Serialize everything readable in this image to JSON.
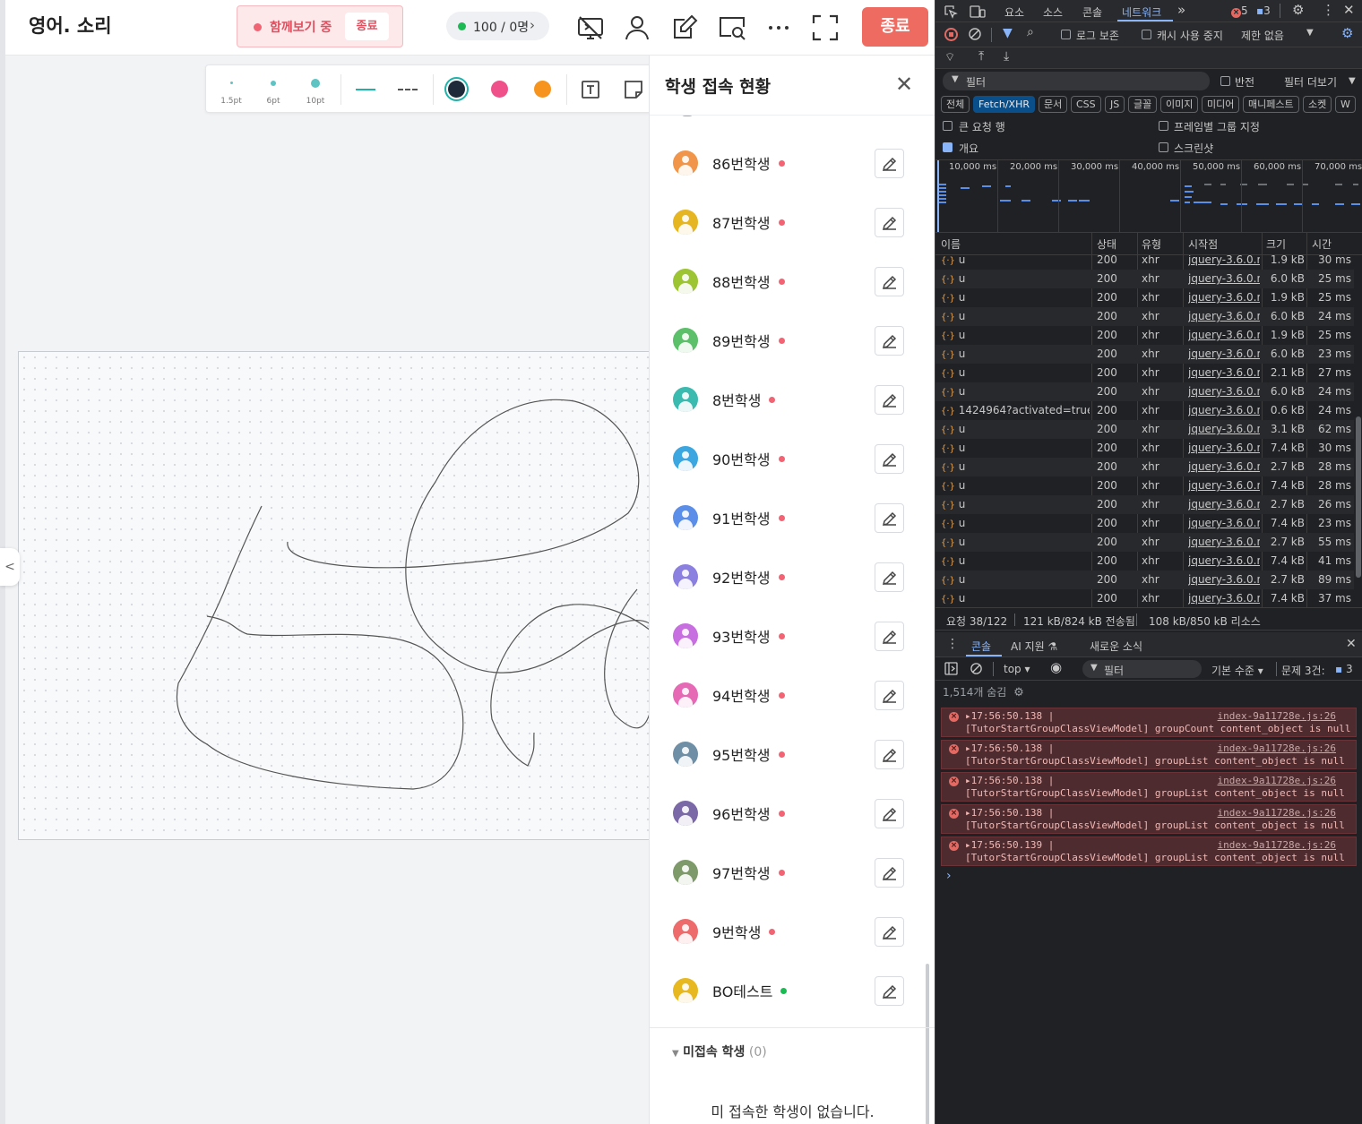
{
  "app": {
    "title": "영어. 소리",
    "together": {
      "label": "함께보기 중",
      "end": "종료"
    },
    "counter": {
      "text": "100 / 0명",
      "chevron": "›"
    },
    "end_button": "종료",
    "toolbar": {
      "pens": [
        "1.5pt",
        "6pt",
        "10pt"
      ],
      "lines": [
        "solid-line",
        "dashed-line"
      ],
      "colors": [
        "#1e2a3a",
        "#f0508a",
        "#f7941d"
      ]
    },
    "left_tab": "<",
    "panel": {
      "title": "학생 접속 현황",
      "close": "✕",
      "students": [
        {
          "name": "86번학생",
          "avatar": "#f0954a",
          "status": "#f06474"
        },
        {
          "name": "87번학생",
          "avatar": "#e6b522",
          "status": "#f06474"
        },
        {
          "name": "88번학생",
          "avatar": "#9cc433",
          "status": "#f06474"
        },
        {
          "name": "89번학생",
          "avatar": "#5cc06a",
          "status": "#f06474"
        },
        {
          "name": "8번학생",
          "avatar": "#3bbab0",
          "status": "#f06474"
        },
        {
          "name": "90번학생",
          "avatar": "#3ba6e0",
          "status": "#f06474"
        },
        {
          "name": "91번학생",
          "avatar": "#5b8ee8",
          "status": "#f06474"
        },
        {
          "name": "92번학생",
          "avatar": "#8b7fe0",
          "status": "#f06474"
        },
        {
          "name": "93번학생",
          "avatar": "#c76ee0",
          "status": "#f06474"
        },
        {
          "name": "94번학생",
          "avatar": "#e669b5",
          "status": "#f06474"
        },
        {
          "name": "95번학생",
          "avatar": "#6f8fa6",
          "status": "#f06474"
        },
        {
          "name": "96번학생",
          "avatar": "#7b68a6",
          "status": "#f06474"
        },
        {
          "name": "97번학생",
          "avatar": "#7f9a6a",
          "status": "#f06474"
        },
        {
          "name": "9번학생",
          "avatar": "#ee6b6b",
          "status": "#f06474"
        },
        {
          "name": "BO테스트",
          "avatar": "#e8b820",
          "status": "#1db954"
        }
      ],
      "offline_label": "미접속 학생",
      "offline_count": "(0)",
      "offline_empty": "미 접속한 학생이 없습니다."
    }
  },
  "devtools": {
    "tabs": [
      "요소",
      "소스",
      "콘솔",
      "네트워크"
    ],
    "more": "»",
    "error_count": "5",
    "message_count": "3",
    "toolbar": {
      "preserve_log": "로그 보존",
      "disable_cache": "캐시 사용 중지",
      "throttle": "제한 없음"
    },
    "filter": {
      "placeholder": "필터",
      "invert": "반전",
      "more_filters": "필터 더보기"
    },
    "types": [
      "전체",
      "Fetch/XHR",
      "문서",
      "CSS",
      "JS",
      "글꼴",
      "이미지",
      "미디어",
      "매니페스트",
      "소켓",
      "W"
    ],
    "options": {
      "big_rows": "큰 요청 행",
      "group_by_frame": "프레임별 그룹 지정",
      "overview": "개요",
      "screenshots": "스크린샷"
    },
    "timeline_ticks": [
      "10,000 ms",
      "20,000 ms",
      "30,000 ms",
      "40,000 ms",
      "50,000 ms",
      "60,000 ms",
      "70,000 ms"
    ],
    "columns": [
      "이름",
      "상태",
      "유형",
      "시작점",
      "크기",
      "시간"
    ],
    "rows": [
      {
        "name": "u",
        "status": "200",
        "type": "xhr",
        "initiator": "jquery-3.6.0.mi",
        "size": "1.9 kB",
        "time": "30 ms"
      },
      {
        "name": "u",
        "status": "200",
        "type": "xhr",
        "initiator": "jquery-3.6.0.mi",
        "size": "6.0 kB",
        "time": "25 ms"
      },
      {
        "name": "u",
        "status": "200",
        "type": "xhr",
        "initiator": "jquery-3.6.0.mi",
        "size": "1.9 kB",
        "time": "25 ms"
      },
      {
        "name": "u",
        "status": "200",
        "type": "xhr",
        "initiator": "jquery-3.6.0.mi",
        "size": "6.0 kB",
        "time": "24 ms"
      },
      {
        "name": "u",
        "status": "200",
        "type": "xhr",
        "initiator": "jquery-3.6.0.mi",
        "size": "1.9 kB",
        "time": "25 ms"
      },
      {
        "name": "u",
        "status": "200",
        "type": "xhr",
        "initiator": "jquery-3.6.0.mi",
        "size": "6.0 kB",
        "time": "23 ms"
      },
      {
        "name": "u",
        "status": "200",
        "type": "xhr",
        "initiator": "jquery-3.6.0.mi",
        "size": "2.1 kB",
        "time": "27 ms"
      },
      {
        "name": "u",
        "status": "200",
        "type": "xhr",
        "initiator": "jquery-3.6.0.mi",
        "size": "6.0 kB",
        "time": "24 ms"
      },
      {
        "name": "1424964?activated=true",
        "status": "200",
        "type": "xhr",
        "initiator": "jquery-3.6.0.mi",
        "size": "0.6 kB",
        "time": "24 ms"
      },
      {
        "name": "u",
        "status": "200",
        "type": "xhr",
        "initiator": "jquery-3.6.0.mi",
        "size": "3.1 kB",
        "time": "62 ms"
      },
      {
        "name": "u",
        "status": "200",
        "type": "xhr",
        "initiator": "jquery-3.6.0.mi",
        "size": "7.4 kB",
        "time": "30 ms"
      },
      {
        "name": "u",
        "status": "200",
        "type": "xhr",
        "initiator": "jquery-3.6.0.mi",
        "size": "2.7 kB",
        "time": "28 ms"
      },
      {
        "name": "u",
        "status": "200",
        "type": "xhr",
        "initiator": "jquery-3.6.0.mi",
        "size": "7.4 kB",
        "time": "28 ms"
      },
      {
        "name": "u",
        "status": "200",
        "type": "xhr",
        "initiator": "jquery-3.6.0.mi",
        "size": "2.7 kB",
        "time": "26 ms"
      },
      {
        "name": "u",
        "status": "200",
        "type": "xhr",
        "initiator": "jquery-3.6.0.mi",
        "size": "7.4 kB",
        "time": "23 ms"
      },
      {
        "name": "u",
        "status": "200",
        "type": "xhr",
        "initiator": "jquery-3.6.0.mi",
        "size": "2.7 kB",
        "time": "55 ms"
      },
      {
        "name": "u",
        "status": "200",
        "type": "xhr",
        "initiator": "jquery-3.6.0.mi",
        "size": "7.4 kB",
        "time": "41 ms"
      },
      {
        "name": "u",
        "status": "200",
        "type": "xhr",
        "initiator": "jquery-3.6.0.mi",
        "size": "2.7 kB",
        "time": "89 ms"
      },
      {
        "name": "u",
        "status": "200",
        "type": "xhr",
        "initiator": "jquery-3.6.0.mi",
        "size": "7.4 kB",
        "time": "37 ms"
      }
    ],
    "summary": {
      "requests": "요청 38/122",
      "transferred": "121 kB/824 kB 전송됨",
      "resources": "108 kB/850 kB 리소스"
    },
    "console_tabs": [
      "콘솔",
      "AI 지원 ⚗",
      "새로운 소식"
    ],
    "console_toolbar": {
      "context": "top ▾",
      "filter": "필터",
      "levels": "기본 수준 ▾",
      "issues": "문제 3건:",
      "issue_count": "3"
    },
    "hidden_count": "1,514개 숨김",
    "errors": [
      {
        "time": "▸17:56:50.138 |",
        "source": "index-9a11728e.js:26",
        "message": "[TutorStartGroupClassViewModel] groupCount content_object is null"
      },
      {
        "time": "▸17:56:50.138 |",
        "source": "index-9a11728e.js:26",
        "message": "[TutorStartGroupClassViewModel] groupList content_object is null"
      },
      {
        "time": "▸17:56:50.138 |",
        "source": "index-9a11728e.js:26",
        "message": "[TutorStartGroupClassViewModel] groupList content_object is null"
      },
      {
        "time": "▸17:56:50.138 |",
        "source": "index-9a11728e.js:26",
        "message": "[TutorStartGroupClassViewModel] groupList content_object is null"
      },
      {
        "time": "▸17:56:50.139 |",
        "source": "index-9a11728e.js:26",
        "message": "[TutorStartGroupClassViewModel] groupList content_object is null"
      }
    ],
    "prompt": "›"
  }
}
